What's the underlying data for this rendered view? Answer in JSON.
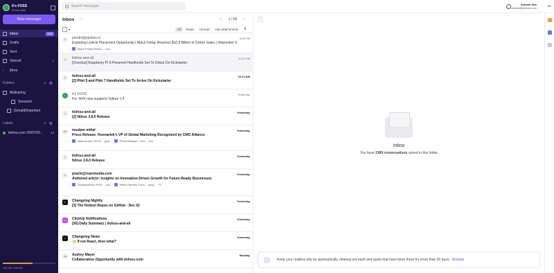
{
  "sidebar": {
    "account": {
      "name": "It's FOSS",
      "sub": "Proton Mail"
    },
    "new_message": "New message",
    "items": [
      {
        "label": "Inbox",
        "badge": "3389",
        "icon": "inbox-icon"
      },
      {
        "label": "Drafts",
        "icon": "draft-icon"
      },
      {
        "label": "Sent",
        "icon": "sent-icon"
      },
      {
        "label": "Starred",
        "count": "1",
        "icon": "star-icon"
      },
      {
        "label": "More",
        "icon": "chevron-down-icon"
      }
    ],
    "folders_title": "Folders",
    "folders": [
      {
        "label": "Mailspring"
      },
      {
        "label": "Snoozed"
      },
      {
        "label": "[Gmail]/Important"
      }
    ],
    "labels_title": "Labels",
    "labels": [
      {
        "label": "itsfoss.com 29/07/20...",
        "count": "14",
        "color": "#3fb950"
      }
    ],
    "storage": {
      "used": "2.81 GB",
      "total": "5.00 GB",
      "fraction": 0.56
    }
  },
  "topbar": {
    "search_placeholder": "Search messages",
    "user_name": "Ankush Das",
    "user_email": "ankush@itsfoss.com",
    "initials": "AD"
  },
  "list": {
    "title": "Inbox",
    "page": "1 / 68",
    "filters": [
      "All",
      "Read",
      "Unread",
      "Has attachments"
    ],
    "messages": [
      {
        "from": "paridhi@jajabox.io",
        "subject": "Exploring Listicle Placement Opportunity | Black Friday Reaches $10.8 Billion in Online Sales | Shiprocket X",
        "time": "6:06 PM",
        "avatar": "P",
        "attachments": [
          "Black Friday Reach... .ocx"
        ],
        "unread": false
      },
      {
        "from": "itsfoss-and-all",
        "subject": "[Overdue] Raspberry Pi 5-Powered Handhelds Set To Debut On Kickstarter",
        "time": "12:11 PM",
        "avatar": "C",
        "unread": false,
        "selected": true
      },
      {
        "from": "itsfoss-and-all",
        "subject": "[2] Pilet 5 and Pilet 7 Handhelds Set To Arrive On Kickstarter",
        "time": "10:14 AM",
        "avatar": "C",
        "unread": true
      },
      {
        "from": "It's FOSS",
        "subject": "Fw: NVK now supports Vulkan 1.4",
        "time": "Yesterday",
        "avatar": "F",
        "unread": false
      },
      {
        "from": "itsfoss-and-all",
        "subject": "[2] Nitrux 3.8.0 Release",
        "time": "Yesterday",
        "avatar": "C",
        "unread": true
      },
      {
        "from": "muskan mittal",
        "subject": "Press Release: Hoonartek's VP of Global Marketing Recognized by CMO Alliance",
        "time": "Yesterday",
        "avatar": "MM",
        "attachments": [
          "Aijaz Ansari, VP Gl... .jpeg",
          "Press Release - Hoo... .ocx"
        ],
        "unread": true
      },
      {
        "from": "itsfoss-and-all",
        "subject": "Nitrux 3.8.0 Release",
        "time": "Yesterday",
        "avatar": "C",
        "unread": true
      },
      {
        "from": "prachi@roarrmedia.com",
        "subject": "Authored article: Insights on Innovation-Driven Growth for Future-Ready Businesses",
        "time": "Yesterday",
        "avatar": "P",
        "attachments": [
          "Spokesperson Profi... .ocx",
          "Rahul Pandey, Foun... .jpeg",
          "+3"
        ],
        "unread": true
      },
      {
        "from": "Changelog Nightly",
        "subject": "[3] The Hottest Repos on GitHub - Dec 02",
        "time": "Yesterday",
        "avatar": "C",
        "unread": true
      },
      {
        "from": "ClickUp Notifications",
        "subject": "[56] Daily Summary | itsfoss-and-all",
        "time": "Yesterday",
        "avatar": "CU",
        "unread": true
      },
      {
        "from": "Changelog News",
        "subject": "👋 If not React, then what?",
        "time": "Yesterday",
        "avatar": "C",
        "unread": true
      },
      {
        "from": "Audrey Mayer",
        "subject": "Collaboration Opportunity with itsfoss.com",
        "time": "Monday",
        "avatar": "AM",
        "unread": true
      }
    ]
  },
  "reading": {
    "empty_title": "Inbox",
    "empty_pre": "You have",
    "empty_count": "3389 conversations",
    "empty_post": "stored in this folder",
    "banner_text": "Keep your mailbox tidy by automatically clearing out trash and spam that have been there for more than 30 days.",
    "banner_link": "Activate"
  },
  "colors": {
    "sidebar": "#1b1340",
    "accent": "#7a5af5",
    "storage": "#e0a03c"
  }
}
